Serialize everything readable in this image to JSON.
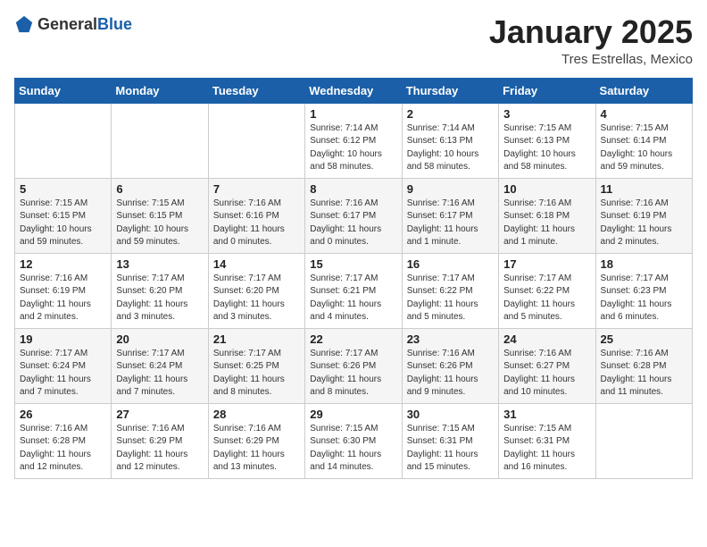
{
  "header": {
    "logo": {
      "general": "General",
      "blue": "Blue"
    },
    "title": "January 2025",
    "subtitle": "Tres Estrellas, Mexico"
  },
  "weekdays": [
    "Sunday",
    "Monday",
    "Tuesday",
    "Wednesday",
    "Thursday",
    "Friday",
    "Saturday"
  ],
  "weeks": [
    [
      {
        "day": "",
        "info": ""
      },
      {
        "day": "",
        "info": ""
      },
      {
        "day": "",
        "info": ""
      },
      {
        "day": "1",
        "info": "Sunrise: 7:14 AM\nSunset: 6:12 PM\nDaylight: 10 hours and 58 minutes."
      },
      {
        "day": "2",
        "info": "Sunrise: 7:14 AM\nSunset: 6:13 PM\nDaylight: 10 hours and 58 minutes."
      },
      {
        "day": "3",
        "info": "Sunrise: 7:15 AM\nSunset: 6:13 PM\nDaylight: 10 hours and 58 minutes."
      },
      {
        "day": "4",
        "info": "Sunrise: 7:15 AM\nSunset: 6:14 PM\nDaylight: 10 hours and 59 minutes."
      }
    ],
    [
      {
        "day": "5",
        "info": "Sunrise: 7:15 AM\nSunset: 6:15 PM\nDaylight: 10 hours and 59 minutes."
      },
      {
        "day": "6",
        "info": "Sunrise: 7:15 AM\nSunset: 6:15 PM\nDaylight: 10 hours and 59 minutes."
      },
      {
        "day": "7",
        "info": "Sunrise: 7:16 AM\nSunset: 6:16 PM\nDaylight: 11 hours and 0 minutes."
      },
      {
        "day": "8",
        "info": "Sunrise: 7:16 AM\nSunset: 6:17 PM\nDaylight: 11 hours and 0 minutes."
      },
      {
        "day": "9",
        "info": "Sunrise: 7:16 AM\nSunset: 6:17 PM\nDaylight: 11 hours and 1 minute."
      },
      {
        "day": "10",
        "info": "Sunrise: 7:16 AM\nSunset: 6:18 PM\nDaylight: 11 hours and 1 minute."
      },
      {
        "day": "11",
        "info": "Sunrise: 7:16 AM\nSunset: 6:19 PM\nDaylight: 11 hours and 2 minutes."
      }
    ],
    [
      {
        "day": "12",
        "info": "Sunrise: 7:16 AM\nSunset: 6:19 PM\nDaylight: 11 hours and 2 minutes."
      },
      {
        "day": "13",
        "info": "Sunrise: 7:17 AM\nSunset: 6:20 PM\nDaylight: 11 hours and 3 minutes."
      },
      {
        "day": "14",
        "info": "Sunrise: 7:17 AM\nSunset: 6:20 PM\nDaylight: 11 hours and 3 minutes."
      },
      {
        "day": "15",
        "info": "Sunrise: 7:17 AM\nSunset: 6:21 PM\nDaylight: 11 hours and 4 minutes."
      },
      {
        "day": "16",
        "info": "Sunrise: 7:17 AM\nSunset: 6:22 PM\nDaylight: 11 hours and 5 minutes."
      },
      {
        "day": "17",
        "info": "Sunrise: 7:17 AM\nSunset: 6:22 PM\nDaylight: 11 hours and 5 minutes."
      },
      {
        "day": "18",
        "info": "Sunrise: 7:17 AM\nSunset: 6:23 PM\nDaylight: 11 hours and 6 minutes."
      }
    ],
    [
      {
        "day": "19",
        "info": "Sunrise: 7:17 AM\nSunset: 6:24 PM\nDaylight: 11 hours and 7 minutes."
      },
      {
        "day": "20",
        "info": "Sunrise: 7:17 AM\nSunset: 6:24 PM\nDaylight: 11 hours and 7 minutes."
      },
      {
        "day": "21",
        "info": "Sunrise: 7:17 AM\nSunset: 6:25 PM\nDaylight: 11 hours and 8 minutes."
      },
      {
        "day": "22",
        "info": "Sunrise: 7:17 AM\nSunset: 6:26 PM\nDaylight: 11 hours and 8 minutes."
      },
      {
        "day": "23",
        "info": "Sunrise: 7:16 AM\nSunset: 6:26 PM\nDaylight: 11 hours and 9 minutes."
      },
      {
        "day": "24",
        "info": "Sunrise: 7:16 AM\nSunset: 6:27 PM\nDaylight: 11 hours and 10 minutes."
      },
      {
        "day": "25",
        "info": "Sunrise: 7:16 AM\nSunset: 6:28 PM\nDaylight: 11 hours and 11 minutes."
      }
    ],
    [
      {
        "day": "26",
        "info": "Sunrise: 7:16 AM\nSunset: 6:28 PM\nDaylight: 11 hours and 12 minutes."
      },
      {
        "day": "27",
        "info": "Sunrise: 7:16 AM\nSunset: 6:29 PM\nDaylight: 11 hours and 12 minutes."
      },
      {
        "day": "28",
        "info": "Sunrise: 7:16 AM\nSunset: 6:29 PM\nDaylight: 11 hours and 13 minutes."
      },
      {
        "day": "29",
        "info": "Sunrise: 7:15 AM\nSunset: 6:30 PM\nDaylight: 11 hours and 14 minutes."
      },
      {
        "day": "30",
        "info": "Sunrise: 7:15 AM\nSunset: 6:31 PM\nDaylight: 11 hours and 15 minutes."
      },
      {
        "day": "31",
        "info": "Sunrise: 7:15 AM\nSunset: 6:31 PM\nDaylight: 11 hours and 16 minutes."
      },
      {
        "day": "",
        "info": ""
      }
    ]
  ]
}
